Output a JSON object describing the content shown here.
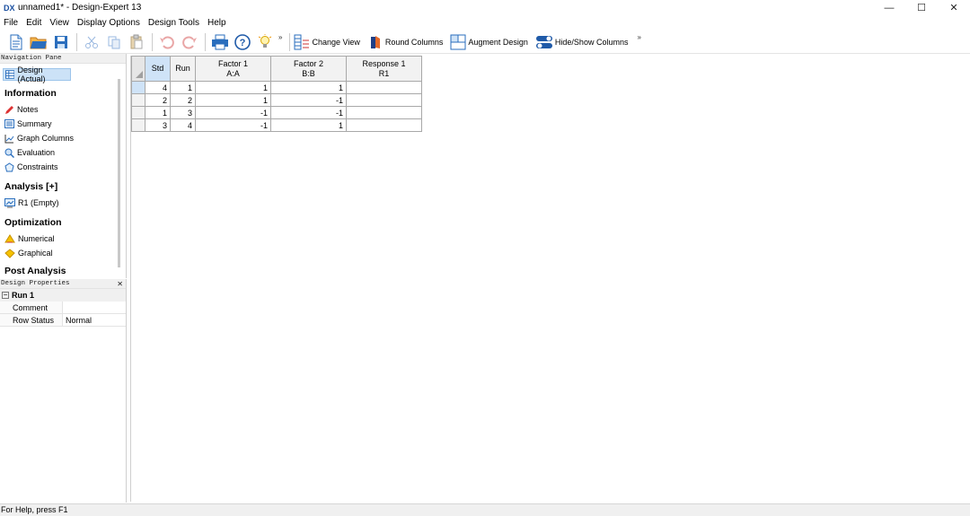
{
  "window": {
    "app_icon": "DX",
    "title": "unnamed1* - Design-Expert 13",
    "controls": {
      "minimize": "—",
      "maximize": "☐",
      "close": "✕"
    }
  },
  "menu": [
    "File",
    "Edit",
    "View",
    "Display Options",
    "Design Tools",
    "Help"
  ],
  "toolbar": {
    "overflow": "»",
    "change_view": "Change View",
    "round_columns": "Round Columns",
    "augment_design": "Augment Design",
    "hide_show_columns": "Hide/Show Columns"
  },
  "nav_pane": {
    "header": "Navigation Pane",
    "selected": "Design (Actual)",
    "groups": [
      {
        "title": "Information",
        "items": [
          "Notes",
          "Summary",
          "Graph Columns",
          "Evaluation",
          "Constraints"
        ]
      },
      {
        "title": "Analysis [+]",
        "items": [
          "R1 (Empty)"
        ]
      },
      {
        "title": "Optimization",
        "items": [
          "Numerical",
          "Graphical"
        ]
      },
      {
        "title": "Post Analysis",
        "items": []
      }
    ]
  },
  "design_properties": {
    "header": "Design Properties",
    "close": "✕",
    "run_label": "Run 1",
    "rows": [
      {
        "key": "Comment",
        "value": ""
      },
      {
        "key": "Row Status",
        "value": "Normal"
      }
    ]
  },
  "grid": {
    "headers": {
      "std": "Std",
      "run": "Run",
      "f1_line1": "Factor 1",
      "f1_line2": "A:A",
      "f2_line1": "Factor 2",
      "f2_line2": "B:B",
      "r1_line1": "Response 1",
      "r1_line2": "R1"
    },
    "rows": [
      {
        "std": "4",
        "run": "1",
        "a": "1",
        "b": "1",
        "r1": ""
      },
      {
        "std": "2",
        "run": "2",
        "a": "1",
        "b": "-1",
        "r1": ""
      },
      {
        "std": "1",
        "run": "3",
        "a": "-1",
        "b": "-1",
        "r1": ""
      },
      {
        "std": "3",
        "run": "4",
        "a": "-1",
        "b": "1",
        "r1": ""
      }
    ]
  },
  "statusbar": {
    "text": "For Help, press F1"
  }
}
